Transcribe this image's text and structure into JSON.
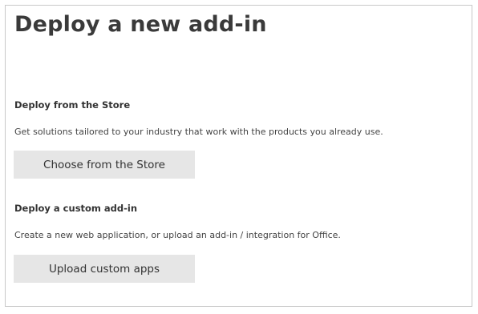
{
  "page": {
    "title": "Deploy a new add-in"
  },
  "store_section": {
    "heading": "Deploy from the Store",
    "description": "Get solutions tailored to your industry that work with the products you already use.",
    "button_label": "Choose from the Store"
  },
  "custom_section": {
    "heading": "Deploy a custom add-in",
    "description": "Create a new web application, or upload an add-in / integration for Office.",
    "button_label": "Upload custom apps"
  }
}
